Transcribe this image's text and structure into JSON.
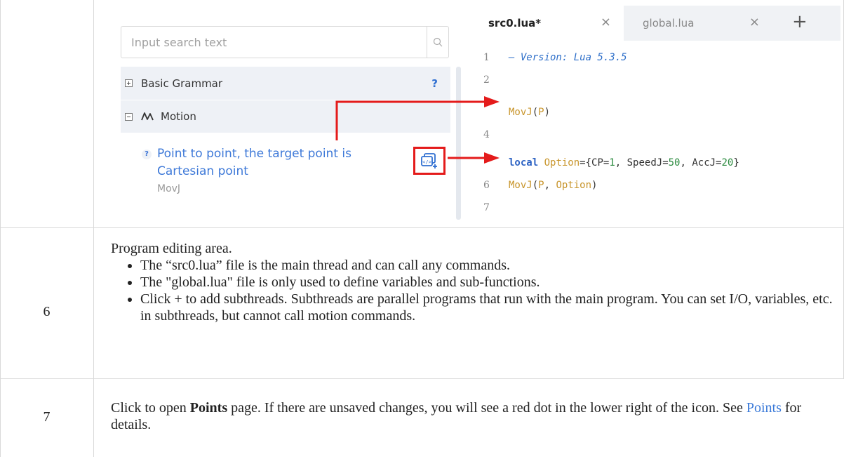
{
  "search": {
    "placeholder": "Input search text"
  },
  "tree": {
    "basic_grammar": {
      "label": "Basic Grammar",
      "help": "?"
    },
    "motion": {
      "label": "Motion"
    },
    "command": {
      "help": "?",
      "title": "Point to point, the target point is Cartesian point",
      "name": "MovJ"
    }
  },
  "editor": {
    "tabs": [
      {
        "label": "src0.lua*",
        "close": "×"
      },
      {
        "label": "global.lua",
        "close": "×"
      }
    ],
    "add_tab": "+",
    "lines": [
      {
        "num": "1",
        "text": "— Version: Lua 5.3.5"
      },
      {
        "num": "2",
        "text": ""
      },
      {
        "num": "",
        "text": "MovJ(P)"
      },
      {
        "num": "4",
        "text": ""
      },
      {
        "num": "",
        "text": "local Option={CP=1, SpeedJ=50, AccJ=20}"
      },
      {
        "num": "6",
        "text": "MovJ(P, Option)"
      },
      {
        "num": "7",
        "text": ""
      }
    ]
  },
  "rows": [
    {
      "num": "6",
      "intro": "Program editing area.",
      "bullets": [
        "The “src0.lua” file is the main thread and can call any commands.",
        "The \"global.lua\" file is only used to define variables and sub-functions.",
        "Click + to add subthreads. Subthreads are parallel programs that run with the main program. You can set I/O, variables, etc. in subthreads, but cannot call motion commands."
      ]
    },
    {
      "num": "7",
      "text_1": "Click to open ",
      "bold": "Points",
      "text_2": " page. If there are unsaved changes, you will see a red dot in the lower right of the icon. See ",
      "link": "Points",
      "text_3": " for details."
    }
  ],
  "colors": {
    "link": "#3b7ad9",
    "arrow": "#e41b1b",
    "accent": "#3e79d8"
  }
}
